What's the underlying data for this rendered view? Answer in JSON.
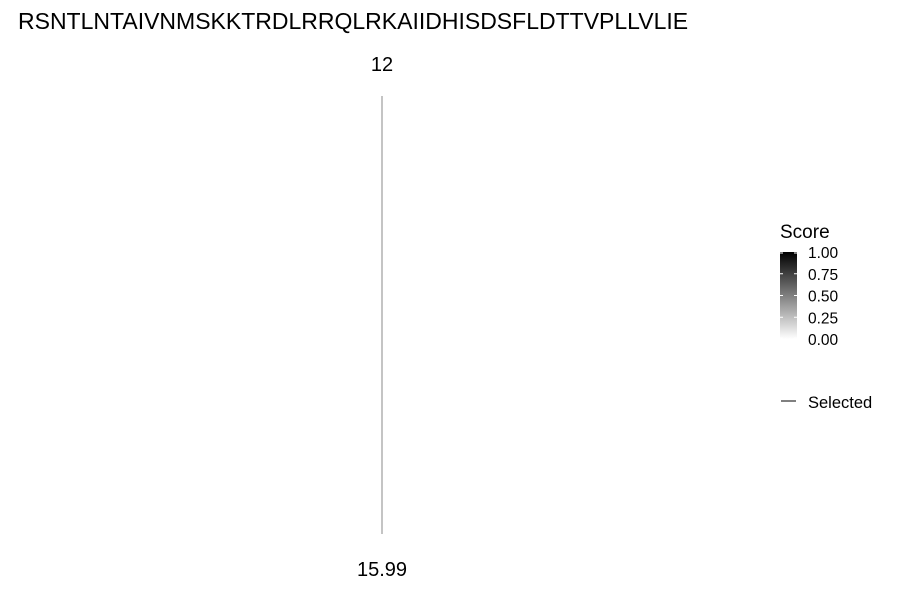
{
  "chart_data": {
    "type": "line",
    "title": "RSNTLNTAIVNMSKKTRDLRRQLRKAIIDHISDSFLDTTVPLLVLIE",
    "top_label": "12",
    "bottom_label": "15.99",
    "series": [
      {
        "name": "Selected",
        "color": "#888888",
        "points": [
          {
            "top": 12,
            "bottom": 15.99
          }
        ]
      }
    ],
    "legend": {
      "placement": "right",
      "score": {
        "title": "Score",
        "ticks": [
          "1.00",
          "0.75",
          "0.50",
          "0.25",
          "0.00"
        ],
        "range": [
          0,
          1
        ],
        "low_color": "#ffffff",
        "high_color": "#000000"
      },
      "selected_label": "Selected"
    },
    "grid": false
  }
}
